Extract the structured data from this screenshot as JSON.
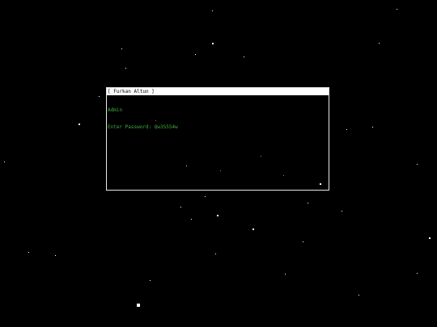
{
  "terminal": {
    "title": "[ Furkan Altun ]",
    "lines": [
      "Admin",
      "Enter Password: Qw3S554w"
    ]
  },
  "colors": {
    "background": "#000000",
    "terminal_text": "#3fae3f",
    "titlebar": "#ffffff",
    "stars": "#ffffff"
  }
}
